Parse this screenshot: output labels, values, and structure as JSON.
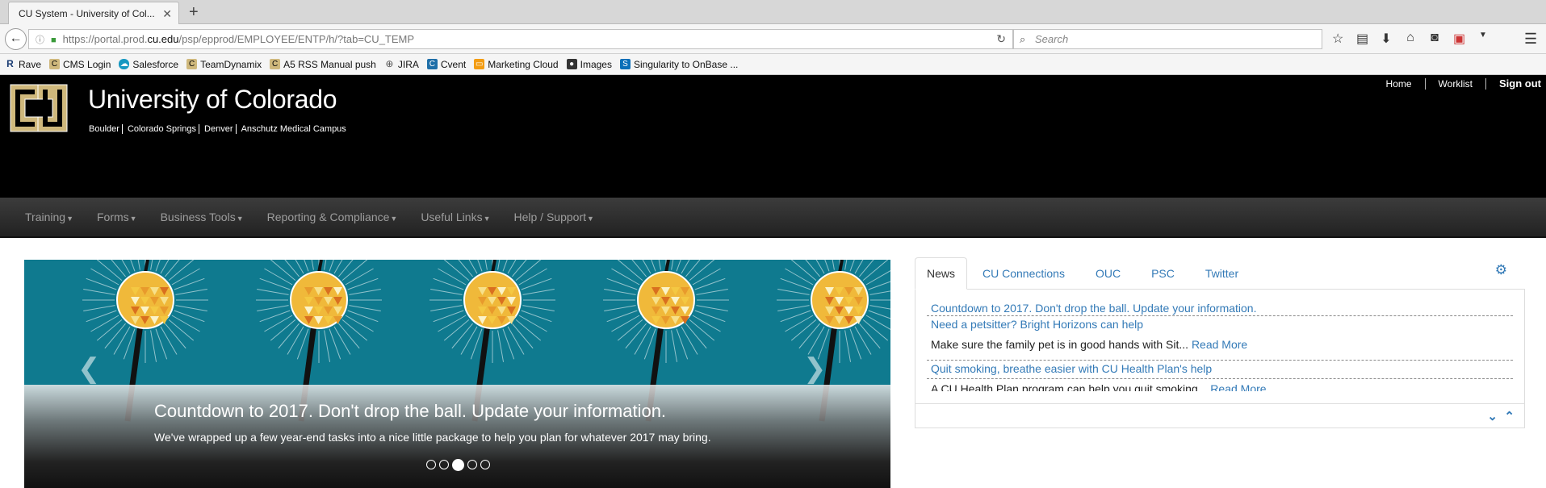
{
  "browser": {
    "tab_title": "CU System - University of Col...",
    "new_tab": "+",
    "url_prefix": "https://portal.prod.",
    "url_domain": "cu.edu",
    "url_suffix": "/psp/epprod/EMPLOYEE/ENTP/h/?tab=CU_TEMP",
    "search_placeholder": "Search",
    "bookmarks": [
      {
        "label": "Rave",
        "icon": "rave-icon"
      },
      {
        "label": "CMS Login",
        "icon": "cu-bookmark-icon"
      },
      {
        "label": "Salesforce",
        "icon": "salesforce-icon"
      },
      {
        "label": "TeamDynamix",
        "icon": "cu-bookmark-icon"
      },
      {
        "label": "A5 RSS Manual push",
        "icon": "cu-bookmark-icon"
      },
      {
        "label": "JIRA",
        "icon": "globe-icon"
      },
      {
        "label": "Cvent",
        "icon": "cvent-icon"
      },
      {
        "label": "Marketing Cloud",
        "icon": "marketing-cloud-icon"
      },
      {
        "label": "Images",
        "icon": "images-icon"
      },
      {
        "label": "Singularity to OnBase ...",
        "icon": "sharepoint-icon"
      }
    ]
  },
  "header": {
    "title": "University of Colorado",
    "campuses": [
      "Boulder",
      "Colorado Springs",
      "Denver",
      "Anschutz Medical Campus"
    ],
    "utility_links": [
      "Home",
      "Worklist",
      "Sign out"
    ]
  },
  "nav": {
    "items": [
      "Training",
      "Forms",
      "Business Tools",
      "Reporting & Compliance",
      "Useful Links",
      "Help / Support"
    ]
  },
  "carousel": {
    "title": "Countdown to 2017. Don't drop the ball. Update your information.",
    "text": "We've wrapped up a few year-end tasks into a nice little package to help you plan for whatever 2017 may bring.",
    "slide_count": 5,
    "active_slide": 3
  },
  "news": {
    "tabs": [
      "News",
      "CU Connections",
      "OUC",
      "PSC",
      "Twitter"
    ],
    "active_tab": "News",
    "items": [
      {
        "title": "Countdown to 2017. Don't drop the ball. Update your information."
      },
      {
        "title": "Need a petsitter? Bright Horizons can help",
        "summary": "Make sure the family pet is in good hands with Sit...",
        "more": "Read More"
      },
      {
        "title": "Quit smoking, breathe easier with CU Health Plan's help",
        "summary": "A CU Health Plan program can help you quit smoking...",
        "more": "Read More"
      }
    ]
  },
  "colors": {
    "header_bg": "#000000",
    "link_blue": "#337ab7",
    "carousel_teal": "#0f7a8f",
    "cu_gold": "#cfb87c"
  }
}
